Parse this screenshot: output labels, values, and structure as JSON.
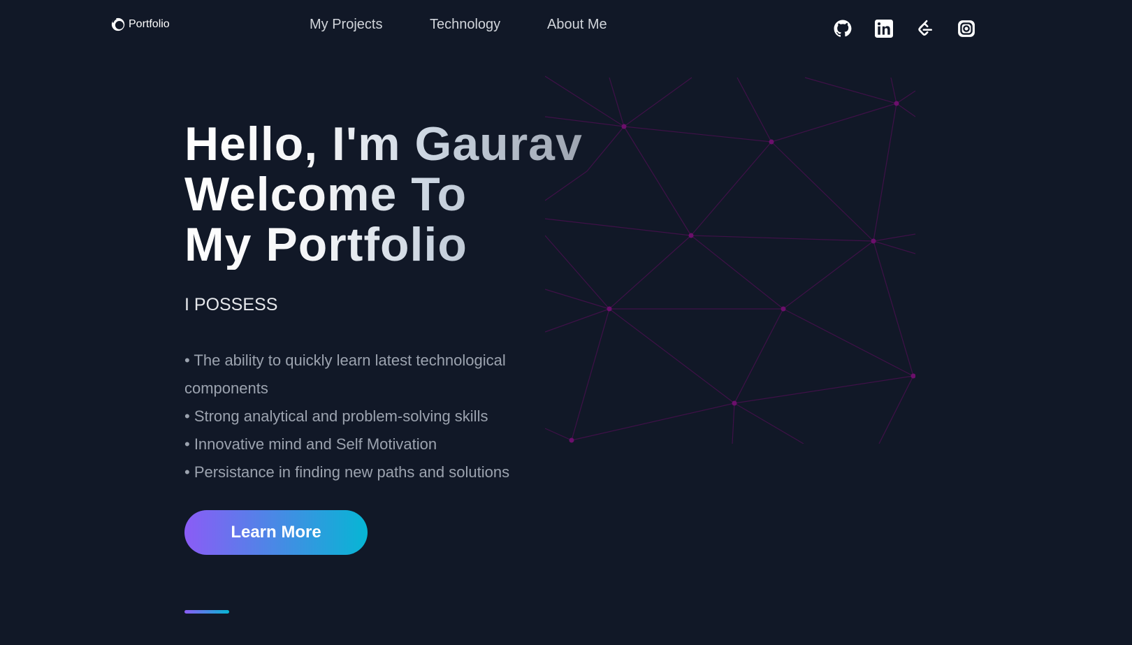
{
  "header": {
    "brand": {
      "label": "Portfolio",
      "icon": "portfolio-logo-icon"
    },
    "nav": [
      {
        "label": "My Projects"
      },
      {
        "label": "Technology"
      },
      {
        "label": "About Me"
      }
    ],
    "socials": [
      {
        "name": "github",
        "icon": "github-icon"
      },
      {
        "name": "linkedin",
        "icon": "linkedin-icon"
      },
      {
        "name": "leetcode",
        "icon": "leetcode-icon"
      },
      {
        "name": "instagram",
        "icon": "instagram-icon"
      }
    ]
  },
  "hero": {
    "title_lines": [
      "Hello, I'm Gaurav",
      "Welcome To",
      "My Portfolio"
    ],
    "subheading": "I POSSESS",
    "bullets": [
      "• The ability to quickly learn latest technological components",
      "• Strong analytical and problem-solving skills",
      "• Innovative mind and Self Motivation",
      "• Persistance in finding new paths and solutions"
    ],
    "cta_label": "Learn More"
  },
  "colors": {
    "background": "#111827",
    "accent_start": "#8b5cf6",
    "accent_end": "#06b6d4",
    "network_line": "#4a1550",
    "network_node": "#6b0f6b"
  }
}
